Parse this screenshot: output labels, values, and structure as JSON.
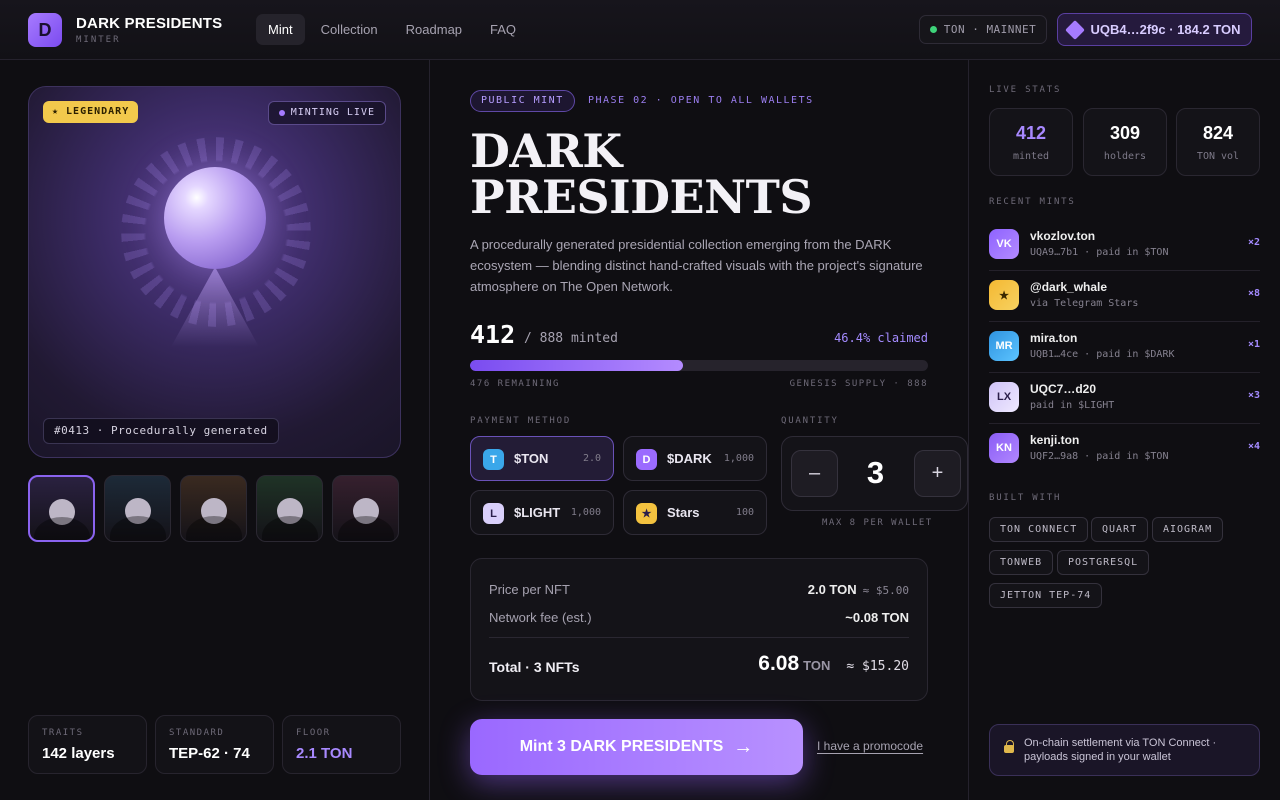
{
  "header": {
    "logo_letter": "D",
    "brand": "DARK PRESIDENTS",
    "brand_sub": "MINTER",
    "nav": [
      "Mint",
      "Collection",
      "Roadmap",
      "FAQ"
    ],
    "network": "TON · MAINNET",
    "wallet": "UQB4…2f9c · 184.2 TON"
  },
  "art": {
    "badge": "★ LEGENDARY",
    "live": "MINTING LIVE",
    "caption": "#0413 · Procedurally generated"
  },
  "thumbs": [
    {
      "bg": "#2a2140"
    },
    {
      "bg": "#1d2a38"
    },
    {
      "bg": "#3a2a20"
    },
    {
      "bg": "#1f3326"
    },
    {
      "bg": "#36202e"
    }
  ],
  "left_stats": [
    {
      "k": "TRAITS",
      "v": "142 layers"
    },
    {
      "k": "STANDARD",
      "v": "TEP-62 · 74"
    },
    {
      "k": "FLOOR",
      "v": "2.1 TON"
    }
  ],
  "mint": {
    "phase_pill": "PUBLIC MINT",
    "phase_text": "PHASE 02 · OPEN TO ALL WALLETS",
    "title_1": "DARK",
    "title_2": "PRESIDENTS",
    "description": "A procedurally generated presidential collection emerging from the DARK ecosystem — blending distinct hand-crafted visuals with the project's signature atmosphere on The Open Network.",
    "minted": "412",
    "minted_of": "/ 888 minted",
    "claimed": "46.4% claimed",
    "progress": 0.464,
    "remaining": "476 REMAINING",
    "genesis": "GENESIS SUPPLY · 888",
    "payment_label": "PAYMENT METHOD",
    "quantity_label": "QUANTITY",
    "payments": [
      {
        "icon": "T",
        "name": "$TON",
        "price": "2.0",
        "color": "#3aa7ea"
      },
      {
        "icon": "D",
        "name": "$DARK",
        "price": "1,000",
        "color": "#9b6bff"
      },
      {
        "icon": "L",
        "name": "$LIGHT",
        "price": "1,000",
        "color": "#d9cffa"
      },
      {
        "icon": "★",
        "name": "Stars",
        "price": "100",
        "color": "#f3c23f"
      }
    ],
    "qty_minus": "–",
    "qty_plus": "+",
    "quantity": "3",
    "max": "MAX 8 PER WALLET",
    "price_label": "Price per NFT",
    "price_value": "2.0 TON",
    "price_usd": "≈ $5.00",
    "fee_label": "Network fee (est.)",
    "fee_value": "~0.08 TON",
    "total_label": "Total · 3 NFTs",
    "total_value": "6.08",
    "total_unit": "TON",
    "total_usd": "≈ $15.20",
    "button": "Mint 3 DARK PRESIDENTS",
    "button_arrow": "→",
    "promo": "I have a promocode"
  },
  "right": {
    "live_label": "LIVE STATS",
    "stats": [
      {
        "n": "412",
        "l": "minted",
        "color": "#a889ff"
      },
      {
        "n": "309",
        "l": "holders",
        "color": "#ffffff"
      },
      {
        "n": "824",
        "l": "TON vol",
        "color": "#ffffff"
      }
    ],
    "recent_label": "RECENT MINTS",
    "recent": [
      {
        "av": "VK",
        "name": "vkozlov.ton",
        "sub": "UQA9…7b1 · paid in $TON",
        "cnt": "×2",
        "c1": "#8e63ff",
        "c2": "#b48bff",
        "fg": "#fff"
      },
      {
        "av": "★",
        "name": "@dark_whale",
        "sub": "via Telegram Stars",
        "cnt": "×8",
        "c1": "#f4b832",
        "c2": "#f7d261",
        "fg": "#3a2800"
      },
      {
        "av": "MR",
        "name": "mira.ton",
        "sub": "UQB1…4ce · paid in $DARK",
        "cnt": "×1",
        "c1": "#2f93e0",
        "c2": "#5cc4ff",
        "fg": "#fff"
      },
      {
        "av": "LX",
        "name": "UQC7…d20",
        "sub": "paid in $LIGHT",
        "cnt": "×3",
        "c1": "#cfc3f7",
        "c2": "#efe9ff",
        "fg": "#2a1e4a"
      },
      {
        "av": "KN",
        "name": "kenji.ton",
        "sub": "UQF2…9a8 · paid in $TON",
        "cnt": "×4",
        "c1": "#8a5df5",
        "c2": "#b187ff",
        "fg": "#fff"
      }
    ],
    "built_label": "BUILT WITH",
    "chips": [
      "TON CONNECT",
      "QUART",
      "AIOGRAM",
      "TONWEB",
      "POSTGRESQL",
      "JETTON TEP-74"
    ],
    "settlement": "On-chain settlement via TON Connect · payloads signed in your wallet"
  }
}
